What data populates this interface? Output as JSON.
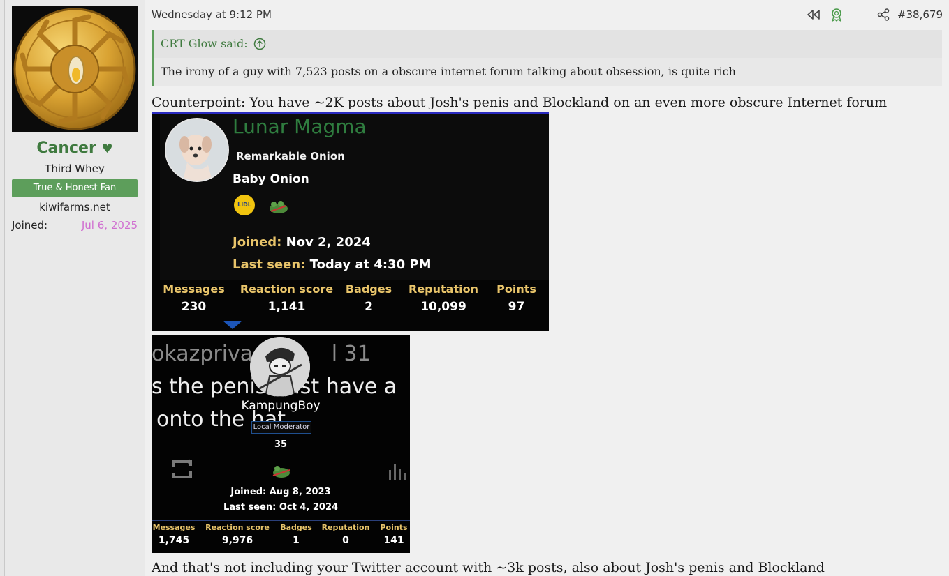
{
  "user": {
    "name": "Cancer",
    "heart_symbol": "♥",
    "title": "Third Whey",
    "banner": "True & Honest Fan",
    "site": "kiwifarms.net",
    "joined_label": "Joined:",
    "joined_value": "Jul 6, 2025"
  },
  "post": {
    "date": "Wednesday at 9:12 PM",
    "number": "#38,679",
    "actions": [
      {
        "icon": "rewind-icon"
      },
      {
        "icon": "award-ribbon-icon"
      },
      {
        "icon": "share-icon"
      }
    ]
  },
  "quote": {
    "author": "CRT Glow said:",
    "text": "The irony of a guy with 7,523 posts on a obscure internet forum talking about obsession, is quite rich"
  },
  "body": {
    "line1": "Counterpoint: You have ~2K posts about Josh's penis and Blockland on an even more obscure Internet forum",
    "line2": "And that's not including your Twitter account with ~3k posts, also about Josh's penis and Blockland"
  },
  "screenshot1": {
    "name": "Lunar Magma",
    "rank": "Remarkable Onion",
    "title": "Baby Onion",
    "badge_text": "LIDL",
    "joined_label": "Joined:",
    "joined_value": "Nov 2, 2024",
    "last_seen_label": "Last seen:",
    "last_seen_value": "Today at 4:30 PM",
    "stats": [
      {
        "label": "Messages",
        "value": "230"
      },
      {
        "label": "Reaction score",
        "value": "1,141"
      },
      {
        "label": "Badges",
        "value": "2"
      },
      {
        "label": "Reputation",
        "value": "10,099"
      },
      {
        "label": "Points",
        "value": "97"
      }
    ]
  },
  "screenshot2": {
    "bg_line1": "okazprivac",
    "bg_line1_end": "l 31",
    "bg_line2": "s the penis",
    "bg_line2_end": "ast have a",
    "bg_line3": "onto the hat",
    "name": "KampungBoy",
    "role": "Local Moderator",
    "count": "35",
    "joined_label": "Joined:",
    "joined_value": "Aug 8, 2023",
    "last_seen_label": "Last seen:",
    "last_seen_value": "Oct 4, 2024",
    "stats": [
      {
        "label": "Messages",
        "value": "1,745"
      },
      {
        "label": "Reaction score",
        "value": "9,976"
      },
      {
        "label": "Badges",
        "value": "1"
      },
      {
        "label": "Reputation",
        "value": "0"
      },
      {
        "label": "Points",
        "value": "141"
      }
    ]
  },
  "colors": {
    "accent_green": "#3f7a3f",
    "banner_green": "#5d9e5b",
    "joined_purple": "#d06dd0",
    "stat_label_gold": "#e8c46a"
  }
}
